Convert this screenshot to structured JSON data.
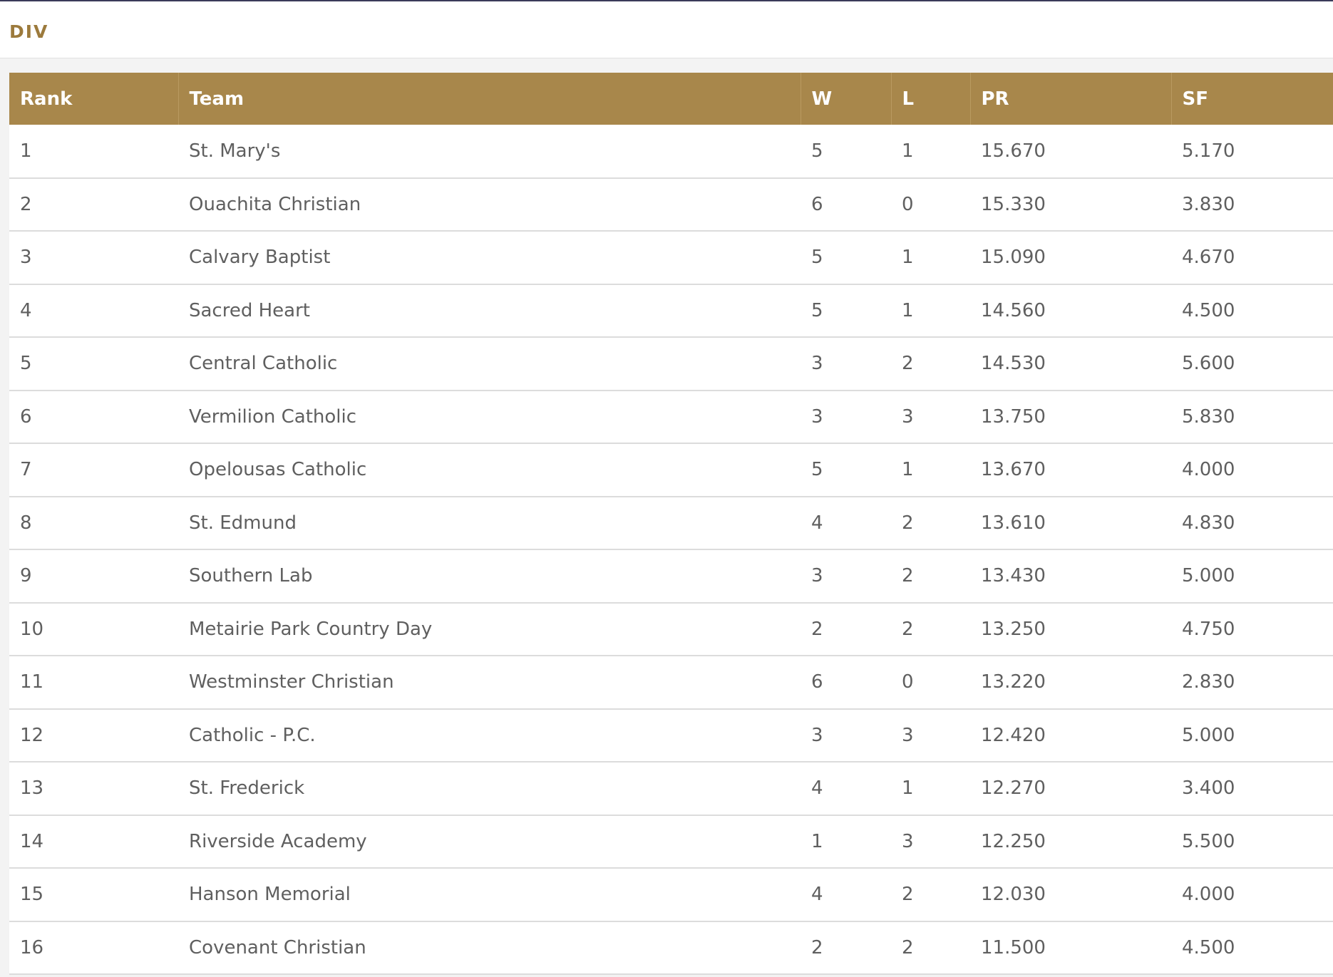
{
  "header": {
    "title": "DIV"
  },
  "table": {
    "columns": [
      "Rank",
      "Team",
      "W",
      "L",
      "PR",
      "SF"
    ],
    "rows": [
      [
        "1",
        "St. Mary's",
        "5",
        "1",
        "15.670",
        "5.170"
      ],
      [
        "2",
        "Ouachita Christian",
        "6",
        "0",
        "15.330",
        "3.830"
      ],
      [
        "3",
        "Calvary Baptist",
        "5",
        "1",
        "15.090",
        "4.670"
      ],
      [
        "4",
        "Sacred Heart",
        "5",
        "1",
        "14.560",
        "4.500"
      ],
      [
        "5",
        "Central Catholic",
        "3",
        "2",
        "14.530",
        "5.600"
      ],
      [
        "6",
        "Vermilion Catholic",
        "3",
        "3",
        "13.750",
        "5.830"
      ],
      [
        "7",
        "Opelousas Catholic",
        "5",
        "1",
        "13.670",
        "4.000"
      ],
      [
        "8",
        "St. Edmund",
        "4",
        "2",
        "13.610",
        "4.830"
      ],
      [
        "9",
        "Southern Lab",
        "3",
        "2",
        "13.430",
        "5.000"
      ],
      [
        "10",
        "Metairie Park Country Day",
        "2",
        "2",
        "13.250",
        "4.750"
      ],
      [
        "11",
        "Westminster Christian",
        "6",
        "0",
        "13.220",
        "2.830"
      ],
      [
        "12",
        "Catholic - P.C.",
        "3",
        "3",
        "12.420",
        "5.000"
      ],
      [
        "13",
        "St. Frederick",
        "4",
        "1",
        "12.270",
        "3.400"
      ],
      [
        "14",
        "Riverside Academy",
        "1",
        "3",
        "12.250",
        "5.500"
      ],
      [
        "15",
        "Hanson Memorial",
        "4",
        "2",
        "12.030",
        "4.000"
      ],
      [
        "16",
        "Covenant Christian",
        "2",
        "2",
        "11.500",
        "4.500"
      ]
    ]
  },
  "colors": {
    "accent": "#a8874b",
    "title": "#9c7a3c",
    "text": "#5f5f5f"
  }
}
